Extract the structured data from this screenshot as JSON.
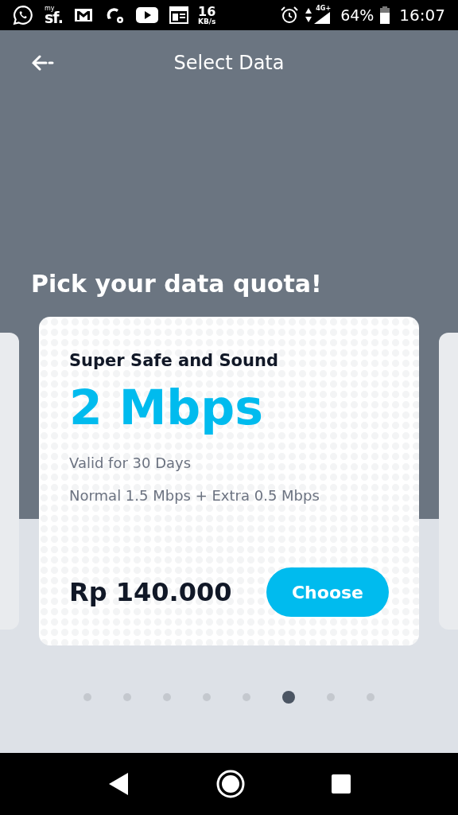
{
  "status_bar": {
    "app_label_small": "my",
    "app_label": "sf.",
    "speed_value": "16",
    "speed_unit": "KB/s",
    "network": "4G+",
    "battery": "64%",
    "time": "16:07"
  },
  "header": {
    "title": "Select Data"
  },
  "heading": "Pick your data quota!",
  "plan": {
    "name": "Super Safe and Sound",
    "speed": "2 Mbps",
    "validity": "Valid for 30 Days",
    "details": "Normal 1.5 Mbps + Extra 0.5 Mbps",
    "price": "Rp 140.000",
    "button": "Choose"
  },
  "pager": [
    {
      "selected": false
    },
    {
      "selected": false
    },
    {
      "selected": false
    },
    {
      "selected": false
    },
    {
      "selected": false
    },
    {
      "selected": true
    },
    {
      "selected": false
    },
    {
      "selected": false
    }
  ]
}
